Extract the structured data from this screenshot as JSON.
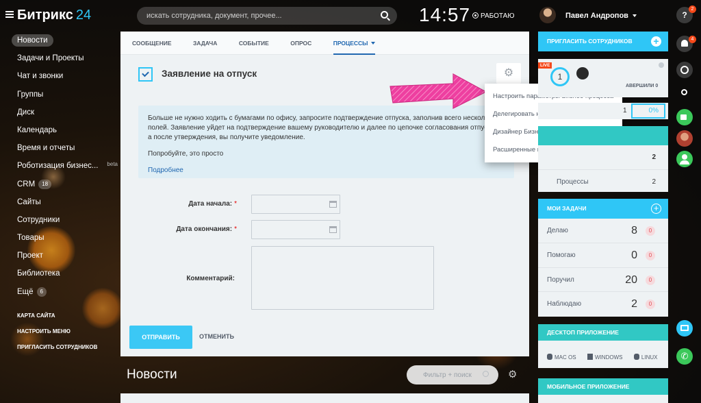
{
  "app": {
    "logo_text": "Битрикс",
    "logo_num": "24"
  },
  "header": {
    "search_placeholder": "искать сотрудника, документ, прочее...",
    "clock": "14:57",
    "status": "РАБОТАЮ",
    "user_name": "Павел Андропов"
  },
  "sidebar": {
    "items": [
      {
        "label": "Новости",
        "active": true
      },
      {
        "label": "Задачи и Проекты"
      },
      {
        "label": "Чат и звонки"
      },
      {
        "label": "Группы"
      },
      {
        "label": "Диск"
      },
      {
        "label": "Календарь"
      },
      {
        "label": "Время и отчеты"
      },
      {
        "label": "Роботизация бизнес...",
        "tag": "beta"
      },
      {
        "label": "CRM",
        "badge": "18"
      },
      {
        "label": "Сайты"
      },
      {
        "label": "Сотрудники"
      },
      {
        "label": "Товары"
      },
      {
        "label": "Проект"
      },
      {
        "label": "Библиотека"
      },
      {
        "label": "Ещё",
        "badge": "6"
      }
    ],
    "links": [
      "КАРТА САЙТА",
      "НАСТРОИТЬ МЕНЮ",
      "ПРИГЛАСИТЬ СОТРУДНИКОВ"
    ]
  },
  "tabs": [
    "СООБЩЕНИЕ",
    "ЗАДАЧА",
    "СОБЫТИЕ",
    "ОПРОС",
    "ПРОЦЕССЫ"
  ],
  "form": {
    "title": "Заявление на отпуск",
    "info_text": "Больше не нужно ходить с бумагами по офису, запросите подтверждение отпуска, заполнив всего несколько полей. Заявление уйдет на подтверждение вашему руководителю и далее по цепочке согласования отпусков, а после утверждения, вы получите уведомление.",
    "try_text": "Попробуйте, это просто",
    "more_link": "Подробнее",
    "label_start": "Дата начала:",
    "label_end": "Дата окончания:",
    "label_comment": "Комментарий:",
    "required_mark": "*",
    "send_button": "ОТПРАВИТЬ",
    "cancel_button": "ОТМЕНИТЬ"
  },
  "popup": {
    "items": [
      "Настроить параметры Бизнес-процесса",
      "Делегировать настройки параметров",
      "Дизайнер Бизнес-процесса",
      "Расширенные настройки"
    ]
  },
  "news": {
    "title": "Новости",
    "filter_placeholder": "Фильтр + поиск"
  },
  "right": {
    "invite_title": "ПРИГЛАСИТЬ СОТРУДНИКОВ",
    "live_label": "LIVE",
    "live_count": "1",
    "completed_label": "АВЕРШИЛИ",
    "completed_count": "0",
    "progress_value": "1",
    "progress_pct": "0%",
    "list_value_1": "2",
    "processes_label": "Процессы",
    "processes_value": "2",
    "tasks_title": "МОИ ЗАДАЧИ",
    "tasks": [
      {
        "label": "Делаю",
        "count": "8",
        "badge": "0"
      },
      {
        "label": "Помогаю",
        "count": "0",
        "badge": "0"
      },
      {
        "label": "Поручил",
        "count": "20",
        "badge": "0"
      },
      {
        "label": "Наблюдаю",
        "count": "2",
        "badge": "0"
      }
    ],
    "desktop_title": "ДЕСКТОП ПРИЛОЖЕНИЕ",
    "os": [
      "MAC OS",
      "WINDOWS",
      "LINUX"
    ],
    "mobile_title": "МОБИЛЬНОЕ ПРИЛОЖЕНИЕ"
  },
  "farbar": {
    "help_badge": "2",
    "notif_badge": "4"
  },
  "colors": {
    "accent": "#2fc6f6",
    "teal": "#31c8c4",
    "link": "#2067b0",
    "arrow": "#ee3fa0"
  }
}
